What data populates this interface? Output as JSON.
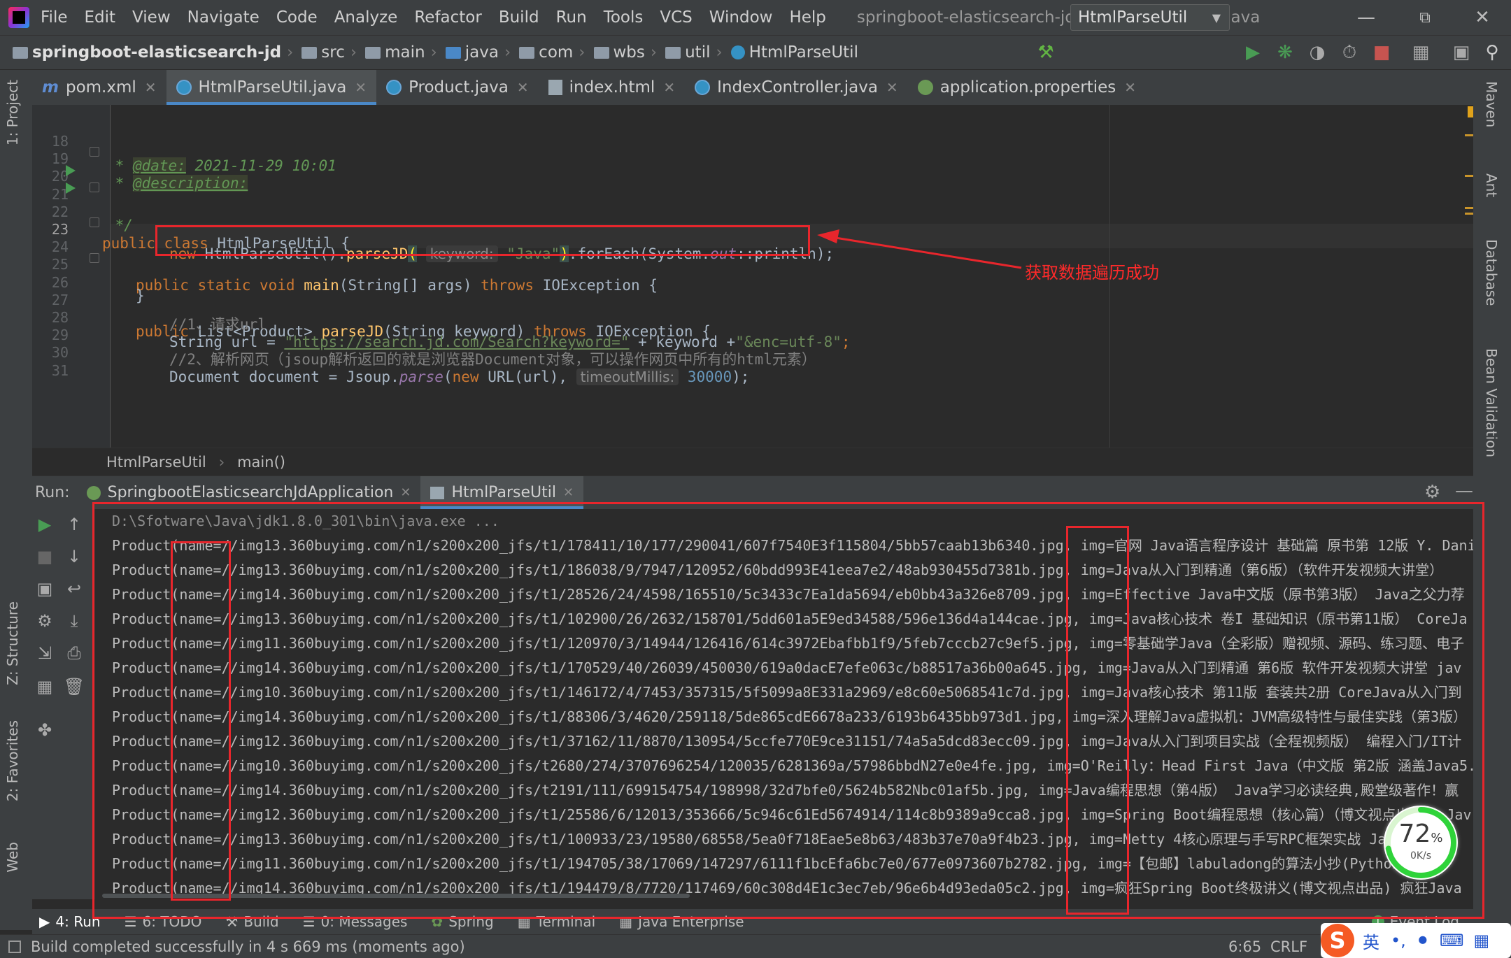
{
  "menu": {
    "items": [
      "File",
      "Edit",
      "View",
      "Navigate",
      "Code",
      "Analyze",
      "Refactor",
      "Build",
      "Run",
      "Tools",
      "VCS",
      "Window",
      "Help"
    ],
    "window_title": "springboot-elasticsearch-jd - ...\\HtmlParseUtil.java"
  },
  "breadcrumb": {
    "project": "springboot-elasticsearch-jd",
    "parts": [
      "src",
      "main",
      "java",
      "com",
      "wbs",
      "util"
    ],
    "file": "HtmlParseUtil"
  },
  "run_config": {
    "label": "HtmlParseUtil"
  },
  "tabs": [
    {
      "label": "pom.xml",
      "icon": "maven-icon",
      "active": false
    },
    {
      "label": "HtmlParseUtil.java",
      "icon": "class-icon",
      "active": true
    },
    {
      "label": "Product.java",
      "icon": "class-icon",
      "active": false
    },
    {
      "label": "index.html",
      "icon": "html-icon",
      "active": false
    },
    {
      "label": "IndexController.java",
      "icon": "class-icon",
      "active": false
    },
    {
      "label": "application.properties",
      "icon": "properties-icon",
      "active": false
    }
  ],
  "left_tools": {
    "project": "1: Project",
    "structure": "Z: Structure",
    "favorites": "2: Favorites",
    "web": "Web"
  },
  "right_tools": {
    "maven": "Maven",
    "ant": "Ant",
    "database": "Database",
    "bean": "Bean Validation"
  },
  "code": {
    "line_numbers": [
      "18",
      "19",
      "20",
      "21",
      "22",
      "23",
      "24",
      "25",
      "26",
      "27",
      "28",
      "29",
      "30",
      "31"
    ],
    "l18_star": " * ",
    "l18_tag": "@date:",
    "l18_val": " 2021-11-29 10:01",
    "l19_star": " * ",
    "l19_tag": "@description:",
    "l20": " */",
    "l21_kw": "public class",
    "l21_rest": " HtmlParseUtil {",
    "l22_kw1": "public static void",
    "l22_fn": "main",
    "l22_mid": "(String[] args) ",
    "l22_kw2": "throws",
    "l22_rest": " IOException {",
    "l23_kw": "new",
    "l23_a": " HtmlParseUtil().",
    "l23_fn": "parseJD",
    "l23_hint": "keyword:",
    "l23_str": "\"Java\"",
    "l23_b": ".forEach(System.",
    "l23_static": "out",
    "l23_c": "::println);",
    "l24": "}",
    "l26_kw": "public",
    "l26_a": " List<Product> ",
    "l26_fn": "parseJD",
    "l26_b": "(String keyword) ",
    "l26_kw2": "throws",
    "l26_c": " IOException {",
    "l27": "//1、请求url",
    "l28_a": "String url = ",
    "l28_url": "\"https://search.jd.com/Search?keyword=\"",
    "l28_b": " + keyword +",
    "l28_str": "\"&enc=utf-8\"",
    "l28_c": ";",
    "l29": "//2、解析网页（jsoup解析返回的就是浏览器Document对象，可以操作网页中所有的html元素）",
    "l30_a": "Document document = Jsoup.",
    "l30_fn": "parse",
    "l30_b": "(",
    "l30_kw": "new",
    "l30_c": " URL(url), ",
    "l30_hint": "timeoutMillis:",
    "l30_num": "30000",
    "l30_d": ");"
  },
  "editor_breadcrumb": {
    "class": "HtmlParseUtil",
    "method": "main()"
  },
  "annotation": {
    "label": "获取数据遍历成功"
  },
  "run_panel": {
    "label": "Run:",
    "tabs": [
      {
        "label": "SpringbootElasticsearchJdApplication",
        "active": false
      },
      {
        "label": "HtmlParseUtil",
        "active": true
      }
    ],
    "command": "D:\\Sfotware\\Java\\jdk1.8.0_301\\bin\\java.exe ...",
    "lines": [
      "Product(name=//img13.360buyimg.com/n1/s200x200_jfs/t1/178411/10/177/290041/607f7540E3f115804/5bb57caab13b6340.jpg, img=官网 Java语言程序设计 基础篇 原书第 12版 Y. Dani",
      "Product(name=//img13.360buyimg.com/n1/s200x200_jfs/t1/186038/9/7947/120952/60bdd993E41eea7e2/48ab930455d7381b.jpg, img=Java从入门到精通（第6版）（软件开发视频大讲堂）",
      "Product(name=//img14.360buyimg.com/n1/s200x200_jfs/t1/28526/24/4598/165510/5c3433c7Ea1da5694/eb0bb43a326e8709.jpg, img=Effective Java中文版（原书第3版） Java之父力荐",
      "Product(name=//img13.360buyimg.com/n1/s200x200_jfs/t1/102900/26/2632/158701/5dd601a5E9ed34588/596e136d4a144cae.jpg, img=Java核心技术 卷I 基础知识（原书第11版） CoreJa",
      "Product(name=//img11.360buyimg.com/n1/s200x200_jfs/t1/120970/3/14944/126416/614c3972Ebafbb1f9/5feb7cccb27c9ef5.jpg, img=零基础学Java（全彩版）赠视频、源码、练习题、电子",
      "Product(name=//img14.360buyimg.com/n1/s200x200_jfs/t1/170529/40/26039/450030/619a0dacE7efe063c/b88517a36b00a645.jpg, img=Java从入门到精通 第6版 软件开发视频大讲堂 jav",
      "Product(name=//img10.360buyimg.com/n1/s200x200_jfs/t1/146172/4/7453/357315/5f5099a8E331a2969/e8c60e5068541c7d.jpg, img=Java核心技术 第11版 套装共2册 CoreJava从入门到",
      "Product(name=//img14.360buyimg.com/n1/s200x200_jfs/t1/88306/3/4620/259118/5de865cdE6678a233/6193b6435bb973d1.jpg, img=深入理解Java虚拟机：JVM高级特性与最佳实践（第3版）",
      "Product(name=//img12.360buyimg.com/n1/s200x200_jfs/t1/37162/11/8870/130954/5ccfe770E9ce31151/74a5a5dcd83ecc09.jpg, img=Java从入门到项目实战（全程视频版） 编程入门/IT计",
      "Product(name=//img10.360buyimg.com/n1/s200x200_jfs/t2680/274/3707696254/120035/6281369a/57986bbdN27e0e4fe.jpg, img=O'Reilly：Head First Java（中文版 第2版 涵盖Java5.",
      "Product(name=//img14.360buyimg.com/n1/s200x200_jfs/t2191/111/699154754/198998/32d7bfe0/5624b582Nbc01af5b.jpg, img=Java编程思想（第4版） Java学习必读经典,殿堂级著作！赢",
      "Product(name=//img12.360buyimg.com/n1/s200x200_jfs/t1/25586/6/12013/353666/5c946c61Ed5674914/114c8b9389a9cca8.jpg, img=Spring Boot编程思想（核心篇）（博文视点出品） Jav",
      "Product(name=//img13.360buyimg.com/n1/s200x200_jfs/t1/100933/23/19580/68558/5ea0f718Eae5e8b63/483b37e70a9f4b23.jpg, img=Netty 4核心原理与手写RPC框架实战 Java",
      "Product(name=//img11.360buyimg.com/n1/s200x200_jfs/t1/194705/38/17069/147297/6111f1bcEfa6bc7e0/677e0973607b2782.jpg, img=【包邮】labuladong的算法小抄(Python C++",
      "Product(name=//img14.360buyimg.com/n1/s200x200_jfs/t1/194479/8/7720/117469/60c308d4E1c3ec7eb/96e6b4d93eda05c2.jpg, img=疯狂Spring Boot终极讲义(博文视点出品) 疯狂Java"
    ]
  },
  "bottom_tools": {
    "run": "4: Run",
    "todo": "6: TODO",
    "build": "Build",
    "messages": "0: Messages",
    "spring": "Spring",
    "terminal": "Terminal",
    "java_enterprise": "Java Enterprise",
    "event_log": "Event Log"
  },
  "status": {
    "message": "Build completed successfully in 4 s 669 ms (moments ago)",
    "position": "6:65",
    "line_sep": "CRLF"
  },
  "speed_widget": {
    "percent": "72",
    "unit": "%",
    "rate": "0K/s"
  },
  "ime": {
    "logo": "S",
    "mode": "英"
  }
}
